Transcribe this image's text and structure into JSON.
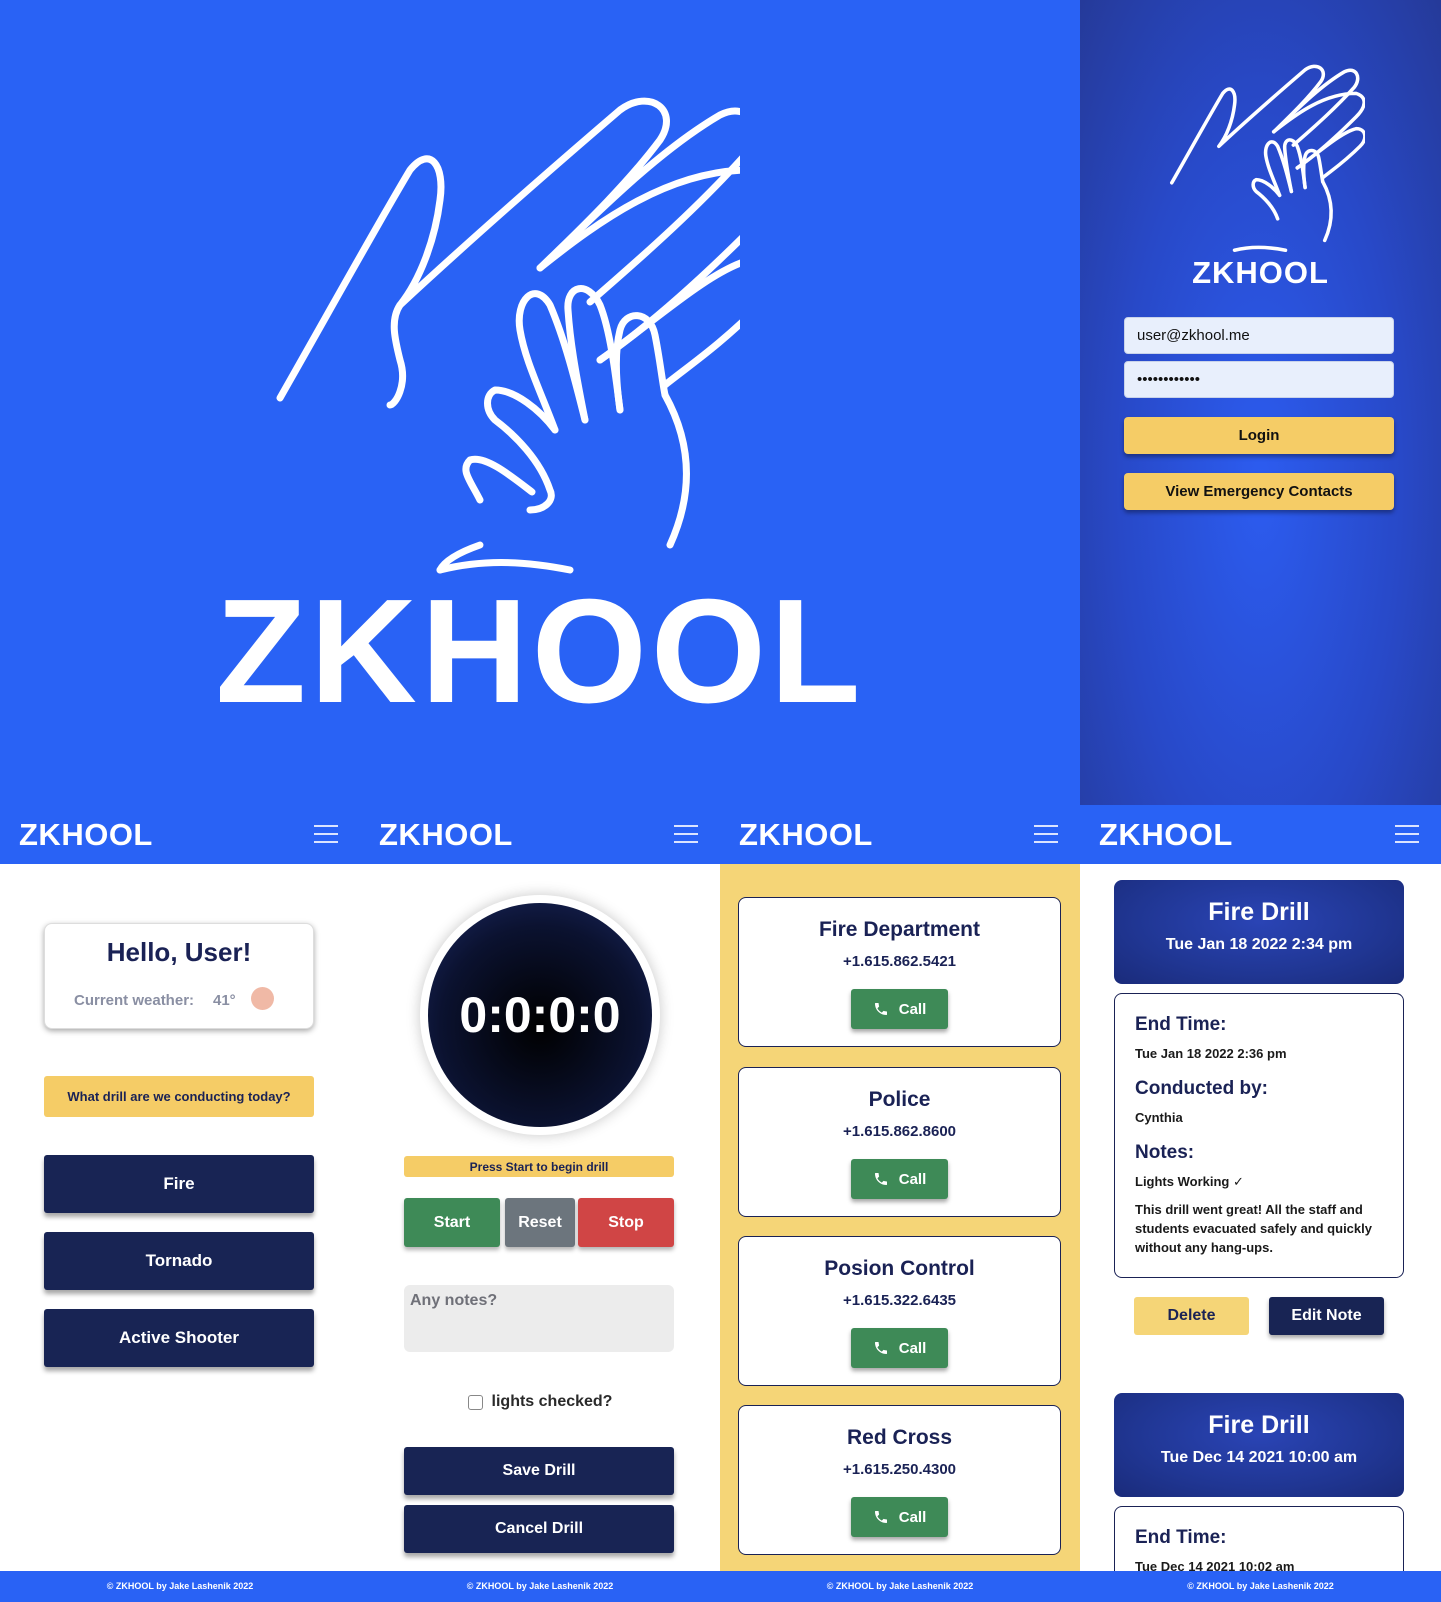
{
  "brand": "ZKHOOL",
  "login": {
    "email_value": "user@zkhool.me",
    "password_value": "••••••••••••",
    "login_label": "Login",
    "contacts_label": "View Emergency Contacts"
  },
  "footer": "© ZKHOOL by Jake Lashenik 2022",
  "home": {
    "greeting": "Hello, User!",
    "weather_label": "Current weather:",
    "weather_value": "41°",
    "question": "What drill are we conducting today?",
    "drills": [
      "Fire",
      "Tornado",
      "Active Shooter"
    ]
  },
  "drill": {
    "timer": "0:0:0:0",
    "status": "Press Start to begin drill",
    "start_label": "Start",
    "reset_label": "Reset",
    "stop_label": "Stop",
    "notes_placeholder": "Any notes?",
    "checkbox_label": "lights checked?",
    "save_label": "Save Drill",
    "cancel_label": "Cancel Drill"
  },
  "contacts": {
    "call_label": "Call",
    "items": [
      {
        "name": "Fire Department",
        "phone": "+1.615.862.5421"
      },
      {
        "name": "Police",
        "phone": "+1.615.862.8600"
      },
      {
        "name": "Posion Control",
        "phone": "+1.615.322.6435"
      },
      {
        "name": "Red Cross",
        "phone": "+1.615.250.4300"
      }
    ]
  },
  "history": {
    "end_time_label": "End Time:",
    "conducted_label": "Conducted by:",
    "notes_label": "Notes:",
    "delete_label": "Delete",
    "edit_label": "Edit Note",
    "records": [
      {
        "title": "Fire Drill",
        "date": "Tue Jan 18 2022 2:34 pm",
        "end_time": "Tue Jan 18 2022 2:36 pm",
        "conducted_by": "Cynthia",
        "checklist": "Lights Working ✓",
        "note_line1": "This drill went great! All the staff and",
        "note_line2": "students evacuated safely and quickly",
        "note_line3": "without any hang-ups."
      },
      {
        "title": "Fire Drill",
        "date": "Tue Dec 14 2021 10:00 am",
        "end_time": "Tue Dec 14 2021 10:02 am"
      }
    ]
  },
  "colors": {
    "brand_blue": "#2962f5",
    "navy": "#182454",
    "yellow": "#f5cc66",
    "green": "#3e8a57",
    "gray": "#6c757d",
    "red": "#d04545"
  }
}
